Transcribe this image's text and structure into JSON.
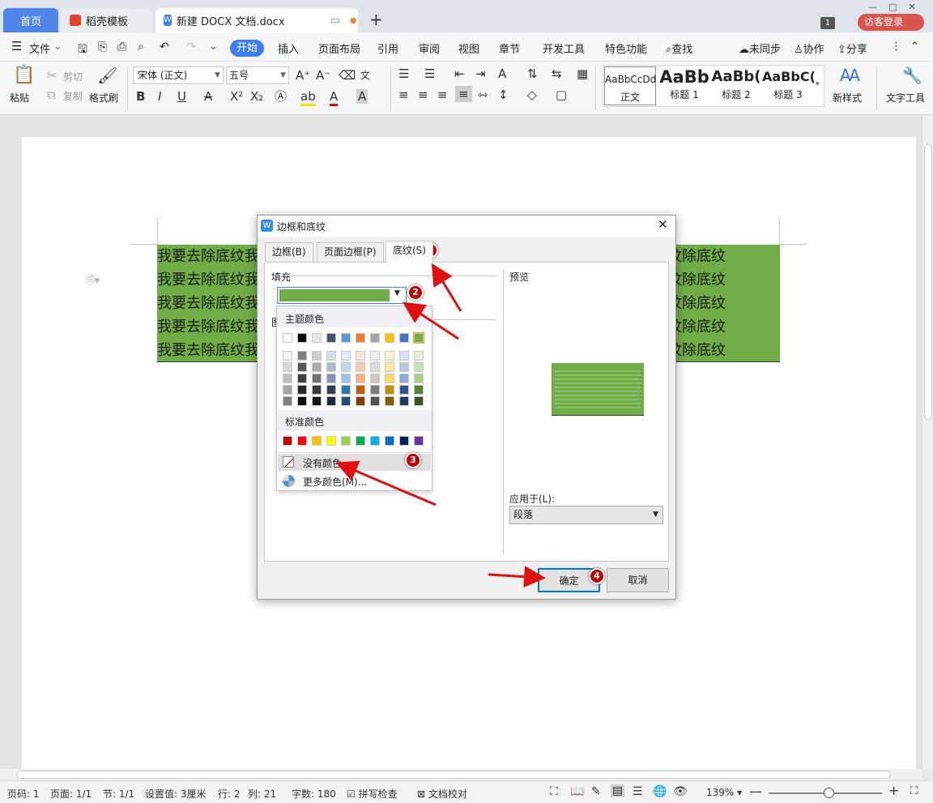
{
  "tabs": {
    "home": "首页",
    "template": "稻壳模板",
    "doc": "新建 DOCX 文档.docx",
    "add": "+",
    "page_badge": "1",
    "login": "访客登录"
  },
  "menu": {
    "file": "文件",
    "items": [
      "开始",
      "插入",
      "页面布局",
      "引用",
      "审阅",
      "视图",
      "章节",
      "开发工具",
      "特色功能"
    ],
    "search": "查找",
    "unsynced": "未同步",
    "collab": "协作",
    "share": "分享"
  },
  "toolbar": {
    "paste": "粘贴",
    "cut": "剪切",
    "copy": "复制",
    "format_painter": "格式刷",
    "font_name": "宋体 (正文)",
    "font_size": "五号",
    "styles": [
      {
        "preview": "AaBbCcDd",
        "label": "正文"
      },
      {
        "preview": "AaBb",
        "label": "标题 1"
      },
      {
        "preview": "AaBb(",
        "label": "标题 2"
      },
      {
        "preview": "AaBbC(",
        "label": "标题 3"
      }
    ],
    "new_style": "新样式",
    "text_tools": "文字工具"
  },
  "document": {
    "lines": [
      "我要去除底纹我要去除底纹我要去除底纹我要去除底纹我要去除底纹我要去除底纹除底纹",
      "我要去除底纹我要去除底纹我要去除底纹我要去除底纹我要去除底纹我要去除底纹除底纹",
      "我要去除底纹我要去除底纹我要去除底纹我要去除底纹我要去除底纹我要去除底纹除底纹",
      "我要去除底纹我要去除底纹我要去除底纹我要去除底纹我要去除底纹我要去除底纹除底纹",
      "我要去除底纹我要去除底纹我要去除底纹我要去除底纹我要去除底纹我要去除底纹除底纹"
    ],
    "shading_color": "#70ad47"
  },
  "dialog": {
    "title": "边框和底纹",
    "tabs": [
      "边框(B)",
      "页面边框(P)",
      "底纹(S)"
    ],
    "fill_label": "填充",
    "pattern_label_partial": "图",
    "preview_label": "预览",
    "apply_label": "应用于(L):",
    "apply_value": "段落",
    "ok": "确定",
    "cancel": "取消"
  },
  "picker": {
    "theme_label": "主题颜色",
    "standard_label": "标准颜色",
    "no_color": "没有颜色",
    "more_colors": "更多颜色(M)...",
    "theme_row": [
      "#ffffff",
      "#000000",
      "#e7e6e6",
      "#44546a",
      "#5b9bd5",
      "#ed7d31",
      "#a5a5a5",
      "#ffc000",
      "#4472c4",
      "#70ad47"
    ],
    "shades": [
      [
        "#f2f2f2",
        "#7f7f7f",
        "#d0cece",
        "#d6dce4",
        "#deebf6",
        "#fbe5d5",
        "#ededed",
        "#fff2cc",
        "#d9e2f3",
        "#e2efd9"
      ],
      [
        "#d8d8d8",
        "#595959",
        "#aeabab",
        "#adb9ca",
        "#bdd7ee",
        "#f7cbac",
        "#dbdbdb",
        "#fee599",
        "#b4c6e7",
        "#c5e0b3"
      ],
      [
        "#bfbfbf",
        "#3f3f3f",
        "#757070",
        "#8496b0",
        "#9dc3e6",
        "#f4b183",
        "#c9c9c9",
        "#ffd966",
        "#8eaadb",
        "#a8d08d"
      ],
      [
        "#a5a5a5",
        "#262626",
        "#3a3838",
        "#323f4f",
        "#2e75b5",
        "#c55a11",
        "#7b7b7b",
        "#bf9000",
        "#2f5496",
        "#538135"
      ],
      [
        "#7f7f7f",
        "#0c0c0c",
        "#171616",
        "#222a35",
        "#1e4e79",
        "#843c0b",
        "#525252",
        "#7f6000",
        "#1f3864",
        "#375623"
      ]
    ],
    "standard_row": [
      "#c00000",
      "#ff0000",
      "#ffc000",
      "#ffff00",
      "#92d050",
      "#00b050",
      "#00b0f0",
      "#0070c0",
      "#002060",
      "#7030a0"
    ]
  },
  "annotations": [
    "1",
    "2",
    "3",
    "4"
  ],
  "status": {
    "page": "页码: 1",
    "pages": "页面: 1/1",
    "section": "节: 1/1",
    "setting": "设置值: 3厘米",
    "row": "行: 2",
    "col": "列: 21",
    "words": "字数: 180",
    "spell": "拼写检查",
    "proof": "文档校对",
    "zoom": "139%"
  }
}
